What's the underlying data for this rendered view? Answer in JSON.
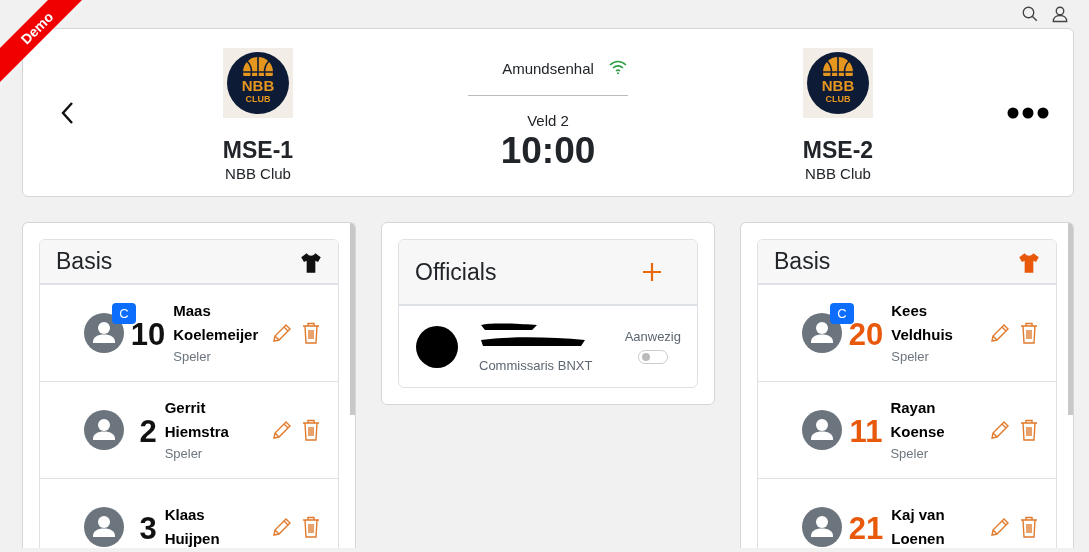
{
  "demo_ribbon": "Demo",
  "match": {
    "venue": "Amundsenhal",
    "court": "Veld 2",
    "time": "10:00",
    "home": {
      "name": "MSE-1",
      "club": "NBB Club",
      "logo": [
        "NBB",
        "CLUB"
      ]
    },
    "away": {
      "name": "MSE-2",
      "club": "NBB Club",
      "logo": [
        "NBB",
        "CLUB"
      ]
    }
  },
  "teams": [
    {
      "title": "Basis",
      "color": "#111111",
      "players": [
        {
          "number": "10",
          "name": "Maas Koelemeijer",
          "role": "Speler",
          "badge": "C"
        },
        {
          "number": "2",
          "name": "Gerrit Hiemstra",
          "role": "Speler"
        },
        {
          "number": "3",
          "name": "Klaas Huijpen"
        }
      ]
    },
    {
      "title": "Basis",
      "color": "#e8590c",
      "players": [
        {
          "number": "20",
          "name": "Kees Veldhuis",
          "role": "Speler",
          "badge": "C"
        },
        {
          "number": "11",
          "name": "Rayan Koense",
          "role": "Speler"
        },
        {
          "number": "21",
          "name": "Kaj van Loenen"
        }
      ]
    }
  ],
  "officials": {
    "title": "Officials",
    "items": [
      {
        "role": "Commissaris BNXT",
        "present_label": "Aanwezig",
        "present": false
      }
    ]
  }
}
